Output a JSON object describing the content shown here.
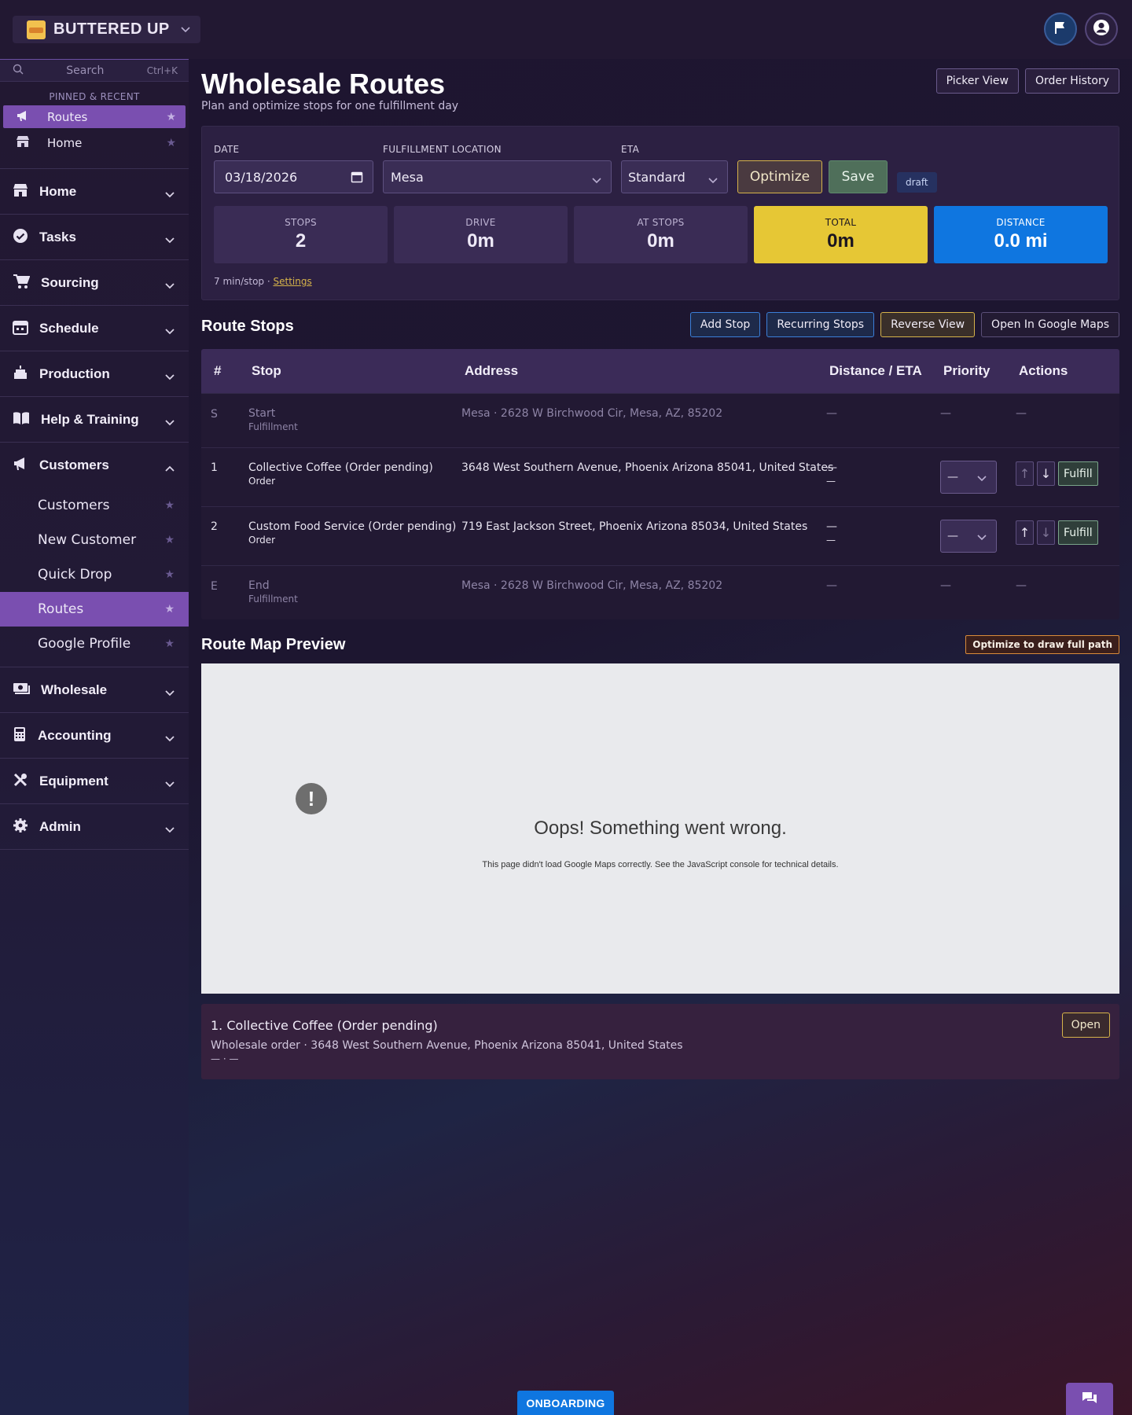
{
  "brand": {
    "name": "BUTTERED UP"
  },
  "topbar": {
    "flag_icon": "flag-icon",
    "user_icon": "user-circle-icon"
  },
  "sidebar": {
    "search": {
      "placeholder": "Search",
      "shortcut": "Ctrl+K"
    },
    "pinned_title": "PINNED & RECENT",
    "pinned": [
      {
        "label": "Routes",
        "icon": "megaphone-icon",
        "active": true
      },
      {
        "label": "Home",
        "icon": "store-icon",
        "active": false
      }
    ],
    "sections": [
      {
        "label": "Home",
        "icon": "store-icon"
      },
      {
        "label": "Tasks",
        "icon": "check-circle-icon"
      },
      {
        "label": "Sourcing",
        "icon": "cart-icon"
      },
      {
        "label": "Schedule",
        "icon": "calendar-icon"
      },
      {
        "label": "Production",
        "icon": "cake-icon"
      },
      {
        "label": "Help & Training",
        "icon": "book-icon"
      },
      {
        "label": "Customers",
        "icon": "megaphone-icon",
        "expanded": true
      },
      {
        "label": "Wholesale",
        "icon": "money-icon"
      },
      {
        "label": "Accounting",
        "icon": "calculator-icon"
      },
      {
        "label": "Equipment",
        "icon": "tools-icon"
      },
      {
        "label": "Admin",
        "icon": "gear-icon"
      }
    ],
    "customers_sub": [
      {
        "label": "Customers"
      },
      {
        "label": "New Customer"
      },
      {
        "label": "Quick Drop"
      },
      {
        "label": "Routes",
        "active": true
      },
      {
        "label": "Google Profile"
      }
    ]
  },
  "page": {
    "title": "Wholesale Routes",
    "subtitle": "Plan and optimize stops for one fulfillment day",
    "picker_view": "Picker View",
    "order_history": "Order History"
  },
  "controls": {
    "date_label": "DATE",
    "date_value": "03/18/2026",
    "location_label": "FULFILLMENT LOCATION",
    "location_value": "Mesa",
    "eta_label": "ETA",
    "eta_value": "Standard",
    "optimize": "Optimize",
    "save": "Save",
    "status": "draft"
  },
  "stats": {
    "stops_label": "STOPS",
    "stops_value": "2",
    "drive_label": "DRIVE",
    "drive_value": "0m",
    "at_stops_label": "AT STOPS",
    "at_stops_value": "0m",
    "total_label": "TOTAL",
    "total_value": "0m",
    "distance_label": "DISTANCE",
    "distance_value": "0.0 mi",
    "total_color": "#e6c735",
    "distance_color": "#0f76e0"
  },
  "footnote": {
    "text": "7 min/stop · ",
    "settings": "Settings"
  },
  "route_stops": {
    "title": "Route Stops",
    "add_stop": "Add Stop",
    "recurring": "Recurring Stops",
    "reverse": "Reverse View",
    "google_maps": "Open In Google Maps",
    "headers": {
      "num": "#",
      "stop": "Stop",
      "address": "Address",
      "dist": "Distance / ETA",
      "priority": "Priority",
      "actions": "Actions"
    },
    "start": {
      "num": "S",
      "name": "Start",
      "type": "Fulfillment",
      "address": "Mesa · 2628 W Birchwood Cir, Mesa, AZ, 85202",
      "dist": "—",
      "priority": "—",
      "actions": "—"
    },
    "rows": [
      {
        "num": "1",
        "name": "Collective Coffee (Order pending)",
        "type": "Order",
        "address": "3648 West Southern Avenue, Phoenix Arizona 85041, United States",
        "dist": "—",
        "eta": "—",
        "priority": "—",
        "up": "↑",
        "down": "↓",
        "fulfill": "Fulfill"
      },
      {
        "num": "2",
        "name": "Custom Food Service (Order pending)",
        "type": "Order",
        "address": "719 East Jackson Street, Phoenix Arizona 85034, United States",
        "dist": "—",
        "eta": "—",
        "priority": "—",
        "up": "↑",
        "down": "↓",
        "fulfill": "Fulfill"
      }
    ],
    "end": {
      "num": "E",
      "name": "End",
      "type": "Fulfillment",
      "address": "Mesa · 2628 W Birchwood Cir, Mesa, AZ, 85202",
      "dist": "—",
      "priority": "—",
      "actions": "—"
    }
  },
  "map": {
    "title": "Route Map Preview",
    "hint": "Optimize to draw full path",
    "error_icon": "!",
    "error_title": "Oops! Something went wrong.",
    "error_text": "This page didn't load Google Maps correctly. See the JavaScript console for technical details."
  },
  "stop_card": {
    "title": "1. Collective Coffee (Order pending)",
    "subtitle": "Wholesale order · 3648 West Southern Avenue, Phoenix Arizona 85041, United States",
    "meta": "— · —",
    "open": "Open"
  },
  "footer": {
    "onboarding": "ONBOARDING",
    "chat_icon": "chat-icon"
  }
}
